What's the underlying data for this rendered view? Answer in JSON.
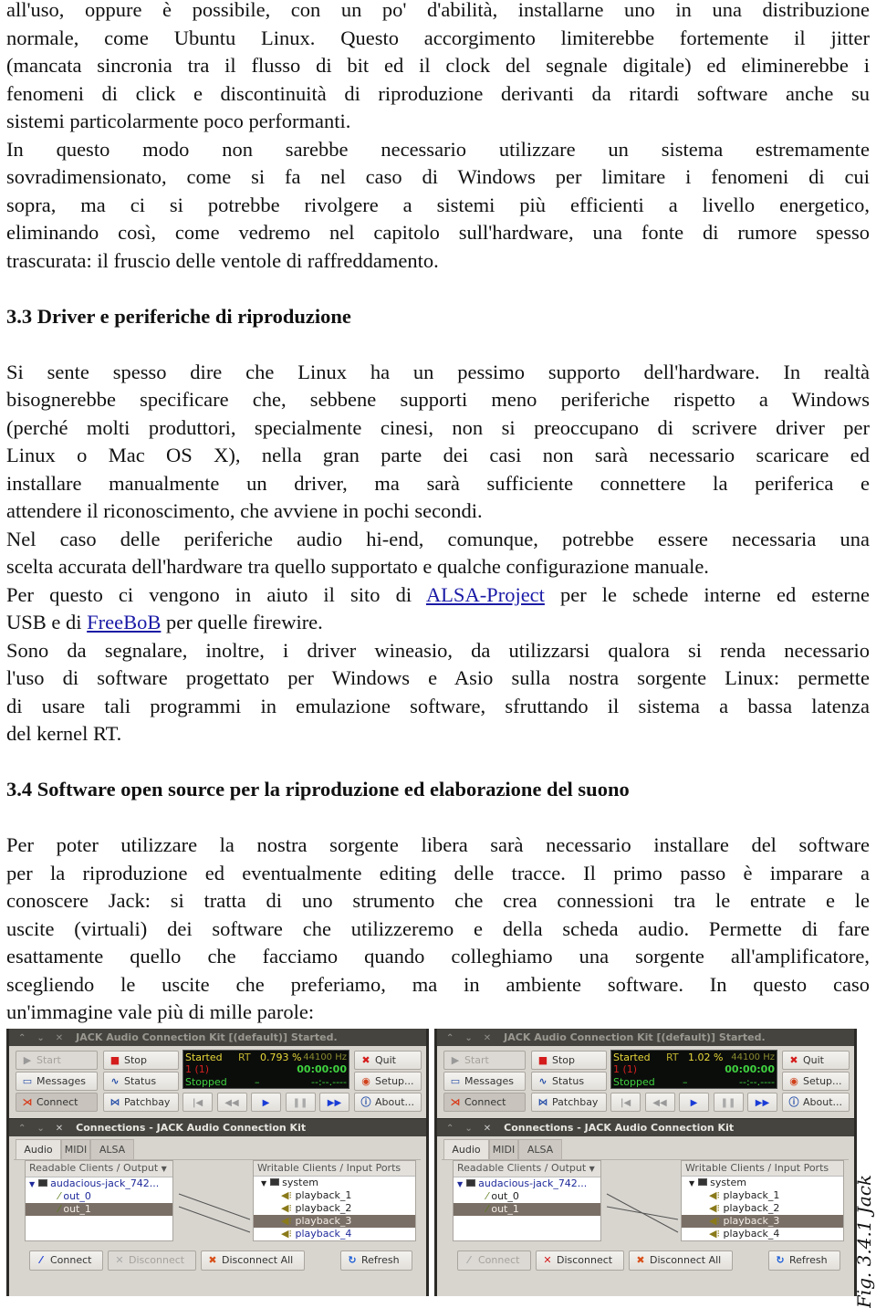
{
  "document": {
    "blocks": [
      {
        "lines": [
          "all'uso, oppure è possibile, con un po' d'abilità, installarne uno in una distribuzione",
          "normale, come Ubuntu Linux. Questo accorgimento limiterebbe fortemente il jitter",
          "(mancata sincronia tra il flusso di bit ed il clock del segnale digitale) ed eliminerebbe i",
          "fenomeni di click e discontinuità di riproduzione derivanti da ritardi software anche su",
          "sistemi particolarmente poco performanti."
        ]
      },
      {
        "lines": [
          "In questo modo non sarebbe necessario utilizzare un sistema estremamente",
          "sovradimensionato, come si fa nel caso di Windows per limitare i fenomeni di cui",
          "sopra, ma ci si potrebbe rivolgere a sistemi più efficienti a livello energetico,",
          "eliminando così, come vedremo nel capitolo sull'hardware, una fonte di rumore spesso",
          "trascurata: il fruscio delle ventole di raffreddamento."
        ]
      },
      {
        "heading": "3.3 Driver e periferiche di riproduzione"
      },
      {
        "lines": [
          "Si sente spesso dire che Linux ha un pessimo supporto dell'hardware. In realtà",
          "bisognerebbe specificare che, sebbene supporti meno periferiche rispetto a Windows",
          "(perché molti produttori, specialmente cinesi, non si preoccupano di scrivere driver per",
          "Linux o Mac OS X), nella gran parte dei casi non sarà necessario scaricare ed",
          "installare manualmente un driver, ma sarà sufficiente connettere la periferica e",
          "attendere il riconoscimento, che avviene in pochi secondi."
        ]
      },
      {
        "lines": [
          "Nel caso delle periferiche audio hi-end, comunque, potrebbe essere necessaria una",
          "scelta accurata dell'hardware tra quello supportato e qualche configurazione manuale."
        ]
      },
      {
        "lines": [
          [
            {
              "text": "Per questo ci vengono in aiuto il sito di "
            },
            {
              "text": "ALSA-Project",
              "link": true
            },
            {
              "text": " per le schede interne ed esterne"
            }
          ],
          [
            {
              "text": "USB e di "
            },
            {
              "text": "FreeBoB",
              "link": true
            },
            {
              "text": " per quelle firewire."
            }
          ]
        ]
      },
      {
        "lines": [
          "Sono da segnalare, inoltre, i driver wineasio, da utilizzarsi qualora si renda necessario",
          "l'uso di software progettato per Windows e Asio sulla nostra sorgente Linux: permette",
          "di usare tali programmi in emulazione software, sfruttando il sistema a bassa latenza",
          "del kernel RT."
        ]
      },
      {
        "heading": "3.4 Software open source per la riproduzione ed elaborazione del suono"
      },
      {
        "lines": [
          "Per poter utilizzare la nostra sorgente libera sarà necessario installare del software",
          "per la riproduzione ed eventualmente editing delle tracce. Il primo passo è imparare a",
          "conoscere Jack: si tratta di uno strumento che crea connessioni tra le entrate e le",
          "uscite (virtuali) dei software che utilizzeremo e della scheda audio. Permette di fare",
          "esattamente quello che facciamo quando colleghiamo una sorgente all'amplificatore,",
          "scegliendo le uscite che preferiamo, ma in ambiente software. In questo caso",
          "un'immagine vale più di mille parole:"
        ]
      }
    ]
  },
  "figure": {
    "caption": "Fig. 3.4.1 Jack",
    "windows": [
      {
        "main_title": "JACK Audio Connection Kit [(default)] Started.",
        "buttons": {
          "start": "Start",
          "stop": "Stop",
          "messages": "Messages",
          "status": "Status",
          "connect": "Connect",
          "patchbay": "Patchbay",
          "quit": "Quit",
          "setup": "Setup...",
          "about": "About..."
        },
        "display": {
          "state": "Started",
          "rt": "RT",
          "dsp_load": "0.793 %",
          "sample_rate": "44100 Hz",
          "xruns": "1 (1)",
          "time": "00:00:00",
          "transport": "Stopped",
          "dash": "–",
          "position": "--:--.----"
        },
        "conn_title": "Connections - JACK Audio Connection Kit",
        "tabs": [
          "Audio",
          "MIDI",
          "ALSA"
        ],
        "readable_header": "Readable Clients / Output",
        "writable_header": "Writable Clients / Input Ports",
        "readable_client": "audacious-jack_742...",
        "outputs": [
          "out_0",
          "out_1"
        ],
        "selected_output": "out_1",
        "writable_client": "system",
        "inputs": [
          "playback_1",
          "playback_2",
          "playback_3",
          "playback_4"
        ],
        "selected_input": "playback_3",
        "connections": [
          [
            "out_0",
            "playback_3"
          ],
          [
            "out_1",
            "playback_4"
          ]
        ],
        "bottom": {
          "connect": "Connect",
          "disconnect": "Disconnect",
          "disconnect_all": "Disconnect All",
          "refresh": "Refresh"
        },
        "connect_enabled": true,
        "disconnect_enabled": false,
        "blue_items": [
          "audacious-jack_742...",
          "out_0",
          "out_1",
          "playback_4"
        ]
      },
      {
        "main_title": "JACK Audio Connection Kit [(default)] Started.",
        "buttons": {
          "start": "Start",
          "stop": "Stop",
          "messages": "Messages",
          "status": "Status",
          "connect": "Connect",
          "patchbay": "Patchbay",
          "quit": "Quit",
          "setup": "Setup...",
          "about": "About..."
        },
        "display": {
          "state": "Started",
          "rt": "RT",
          "dsp_load": "1.02 %",
          "sample_rate": "44100 Hz",
          "xruns": "1 (1)",
          "time": "00:00:00",
          "transport": "Stopped",
          "dash": "–",
          "position": "--:--.----"
        },
        "conn_title": "Connections - JACK Audio Connection Kit",
        "tabs": [
          "Audio",
          "MIDI",
          "ALSA"
        ],
        "readable_header": "Readable Clients / Output",
        "writable_header": "Writable Clients / Input Ports",
        "readable_client": "audacious-jack_742...",
        "outputs": [
          "out_0",
          "out_1"
        ],
        "selected_output": "out_1",
        "writable_client": "system",
        "inputs": [
          "playback_1",
          "playback_2",
          "playback_3",
          "playback_4"
        ],
        "selected_input": "playback_3",
        "connections": [
          [
            "out_0",
            "playback_4"
          ],
          [
            "out_1",
            "playback_3"
          ]
        ],
        "bottom": {
          "connect": "Connect",
          "disconnect": "Disconnect",
          "disconnect_all": "Disconnect All",
          "refresh": "Refresh"
        },
        "connect_enabled": false,
        "disconnect_enabled": true,
        "blue_items": [
          "audacious-jack_742..."
        ]
      }
    ],
    "colors": {
      "display_bg": "#0b0d0b",
      "display_yellow": "#e8d83a",
      "display_green": "#3fd13f",
      "display_red": "#d42020",
      "selection": "#7a6f66",
      "link": "#1a1aa6"
    }
  }
}
